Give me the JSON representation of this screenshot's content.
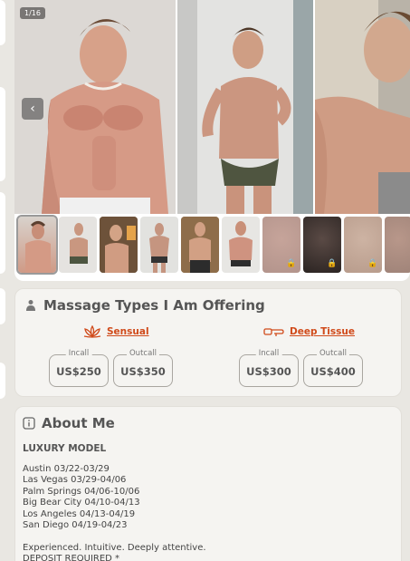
{
  "gallery": {
    "counter": "1/16",
    "prev_icon": "chevron-left-icon",
    "thumbnails": [
      {
        "locked": false
      },
      {
        "locked": false
      },
      {
        "locked": false
      },
      {
        "locked": false
      },
      {
        "locked": false
      },
      {
        "locked": false
      },
      {
        "locked": true
      },
      {
        "locked": true
      },
      {
        "locked": true
      },
      {
        "locked": true
      }
    ],
    "lock_glyph": "🔒"
  },
  "massage": {
    "title": "Massage Types I Am Offering",
    "title_icon": "masseur-icon",
    "types": [
      {
        "name": "Sensual",
        "icon": "lotus-icon",
        "incall_label": "Incall",
        "incall_price": "US$250",
        "outcall_label": "Outcall",
        "outcall_price": "US$350"
      },
      {
        "name": "Deep Tissue",
        "icon": "massage-hand-icon",
        "incall_label": "Incall",
        "incall_price": "US$300",
        "outcall_label": "Outcall",
        "outcall_price": "US$400"
      }
    ]
  },
  "about": {
    "title": "About Me",
    "title_icon": "info-icon",
    "subtitle": "LUXURY MODEL",
    "schedule": [
      "Austin 03/22-03/29",
      "Las Vegas 03/29-04/06",
      "Palm Springs 04/06-10/06",
      "Big Bear City 04/10-04/13",
      "Los Angeles 04/13-04/19",
      "San Diego 04/19-04/23"
    ],
    "tagline": "Experienced. Intuitive. Deeply attentive.",
    "deposit": "DEPOSIT REQUIRED *"
  },
  "colors": {
    "accent": "#d04a1a",
    "card_bg": "#f5f4f1",
    "page_bg": "#e9e7e2"
  }
}
